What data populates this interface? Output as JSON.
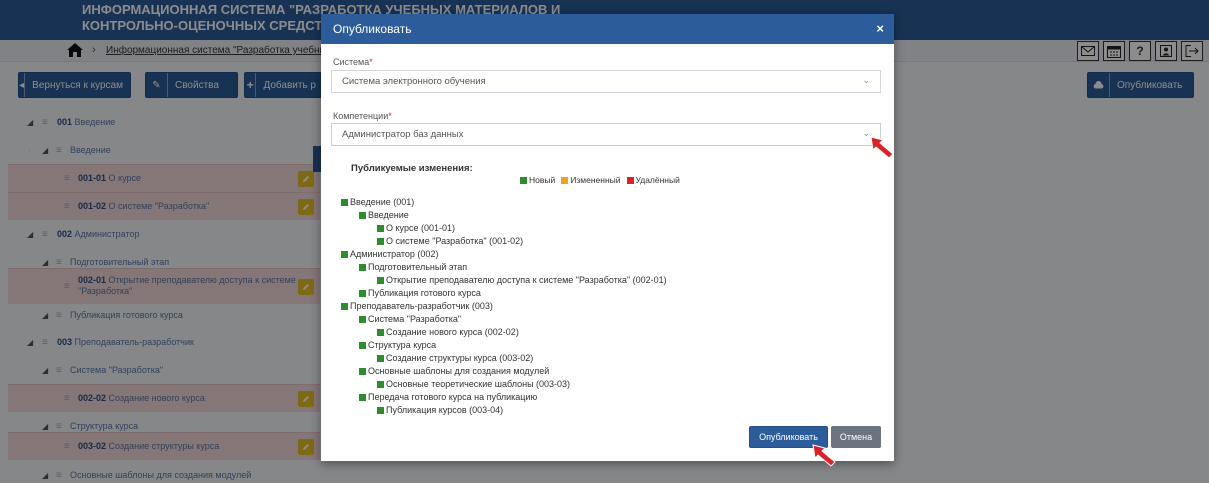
{
  "header": {
    "title_line1": "ИНФОРМАЦИОННАЯ СИСТЕМА \"РАЗРАБОТКА УЧЕБНЫХ МАТЕРИАЛОВ И",
    "title_line2": "КОНТРОЛЬНО-ОЦЕНОЧНЫХ СРЕДСТВ\"",
    "breadcrumb": "Информационная система \"Разработка учебных матер",
    "icons": [
      "mail-icon",
      "calendar-icon",
      "help-icon",
      "profile-icon",
      "logout-icon"
    ]
  },
  "toolbar": {
    "back_label": "Вернуться к курсам",
    "properties_label": "Свойства",
    "add_label": "Добавить р",
    "publish_label": "Опубликовать"
  },
  "tree": [
    {
      "code": "001",
      "label": "Введение"
    },
    {
      "label": "Введение"
    },
    {
      "code": "001-01",
      "label": "О курсе"
    },
    {
      "code": "001-02",
      "label": "О системе \"Разработка\""
    },
    {
      "code": "002",
      "label": "Администратор"
    },
    {
      "label": "Подготовительный этап"
    },
    {
      "code": "002-01",
      "label_line1": "Открытие преподавателю доступа к системе",
      "label_line2": "\"Разработка\""
    },
    {
      "label": "Публикация готового курса"
    },
    {
      "code": "003",
      "label": "Преподаватель-разработчик"
    },
    {
      "label": "Система \"Разработка\""
    },
    {
      "code": "002-02",
      "label": "Создание нового курса"
    },
    {
      "label": "Структура курса"
    },
    {
      "code": "003-02",
      "label": "Создание структуры курса"
    },
    {
      "label": "Основные шаблоны для создания модулей"
    }
  ],
  "modal": {
    "title": "Опубликовать",
    "close": "×",
    "system_label": "Система",
    "system_value": "Система электронного обучения",
    "competence_label": "Компетенции",
    "competence_value": "Администратор баз данных",
    "required_mark": "*",
    "changes_title": "Публикуемые изменения:",
    "legend": {
      "new": "Новый",
      "changed": "Измененный",
      "deleted": "Удалённый"
    },
    "changes": [
      "Введение (001)",
      "Введение",
      "О курсе (001-01)",
      "О системе \"Разработка\" (001-02)",
      "Администратор (002)",
      "Подготовительный этап",
      "Открытие преподавателю доступа к системе \"Разработка\" (002-01)",
      "Публикация готового курса",
      "Преподаватель-разработчик (003)",
      "Система \"Разработка\"",
      "Создание нового курса (002-02)",
      "Структура курса",
      "Создание структуры курса (003-02)",
      "Основные шаблоны для создания модулей",
      "Основные теоретические шаблоны (003-03)",
      "Передача готового курса на публикацию",
      "Публикация курсов (003-04)"
    ],
    "publish_button": "Опубликовать",
    "cancel_button": "Отмена"
  },
  "colors": {
    "primary": "#2c5c9a",
    "new": "#2e8b2e",
    "changed": "#f0a020",
    "deleted": "#d8232a",
    "annotation_arrow": "#d8232a"
  }
}
